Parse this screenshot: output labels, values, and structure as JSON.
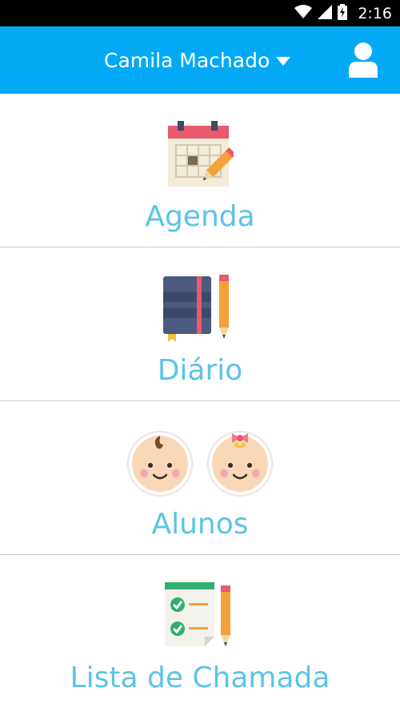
{
  "status_bar": {
    "time": "2:16",
    "icons": [
      "wifi-icon",
      "signal-icon",
      "battery-icon"
    ]
  },
  "header": {
    "account_name": "Camila Machado",
    "icons": [
      "chevron-down-icon",
      "user-profile-icon"
    ],
    "background_color": "#03a9f4"
  },
  "menu": {
    "label_color": "#5bc4e6",
    "items": [
      {
        "label": "Agenda",
        "icon": "calendar-icon"
      },
      {
        "label": "Diário",
        "icon": "notebook-pencil-icon"
      },
      {
        "label": "Alunos",
        "icon": "children-icon"
      },
      {
        "label": "Lista de Chamada",
        "icon": "checklist-icon"
      }
    ]
  }
}
